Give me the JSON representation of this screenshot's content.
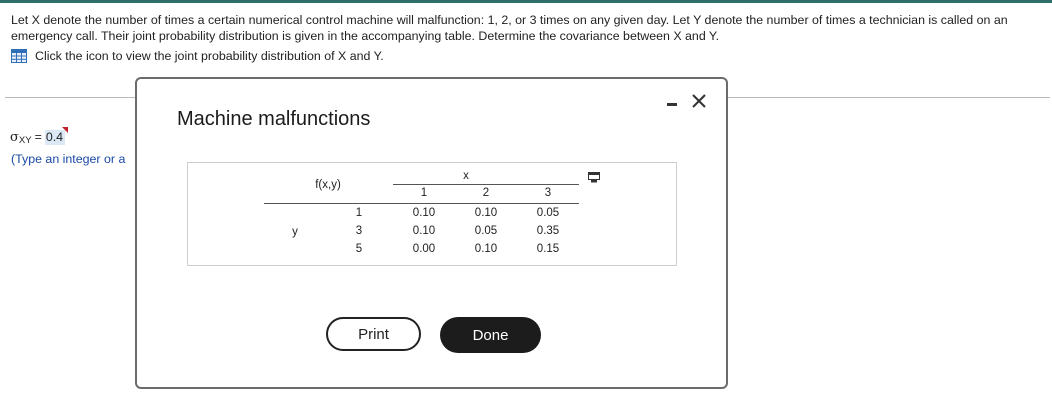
{
  "question": {
    "text": "Let X denote the number of times a certain numerical control machine will malfunction: 1, 2, or 3 times on any given day. Let Y denote the number of times a technician is called on an emergency call. Their joint probability distribution is given in the accompanying table. Determine the covariance between X and Y.",
    "hint": "Click the icon to view the joint probability distribution of X and Y."
  },
  "answer": {
    "symbol": "σ",
    "subscript": "XY",
    "equals": "=",
    "value": "0.4",
    "type_hint": "(Type an integer or a"
  },
  "modal": {
    "title": "Machine malfunctions",
    "table": {
      "corner_label": "f(x,y)",
      "x_label": "x",
      "y_label": "y",
      "x_values": [
        "1",
        "2",
        "3"
      ],
      "y_values": [
        "1",
        "3",
        "5"
      ],
      "rows": [
        [
          "0.10",
          "0.10",
          "0.05"
        ],
        [
          "0.10",
          "0.05",
          "0.35"
        ],
        [
          "0.00",
          "0.10",
          "0.15"
        ]
      ]
    },
    "print_label": "Print",
    "done_label": "Done"
  },
  "colors": {
    "accent": "#2e6f6a",
    "answer_highlight": "#dbe9f6",
    "hint_link": "#1a4aa6",
    "done_button": "#1c1c1c"
  }
}
